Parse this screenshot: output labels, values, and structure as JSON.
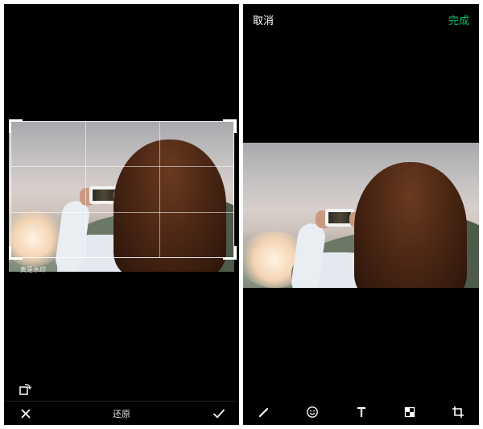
{
  "crop_screen": {
    "watermark_text": "寅是水印",
    "bottom_bar": {
      "close_icon": "close-icon",
      "restore_label": "还原",
      "confirm_icon": "check-icon"
    },
    "rotate_icon": "rotate-icon"
  },
  "edit_screen": {
    "header": {
      "cancel_label": "取消",
      "done_label": "完成",
      "done_color": "#07c160"
    },
    "toolbar": [
      {
        "name": "pen-icon"
      },
      {
        "name": "emoji-icon"
      },
      {
        "name": "text-icon"
      },
      {
        "name": "mosaic-icon"
      },
      {
        "name": "crop-icon"
      }
    ]
  }
}
